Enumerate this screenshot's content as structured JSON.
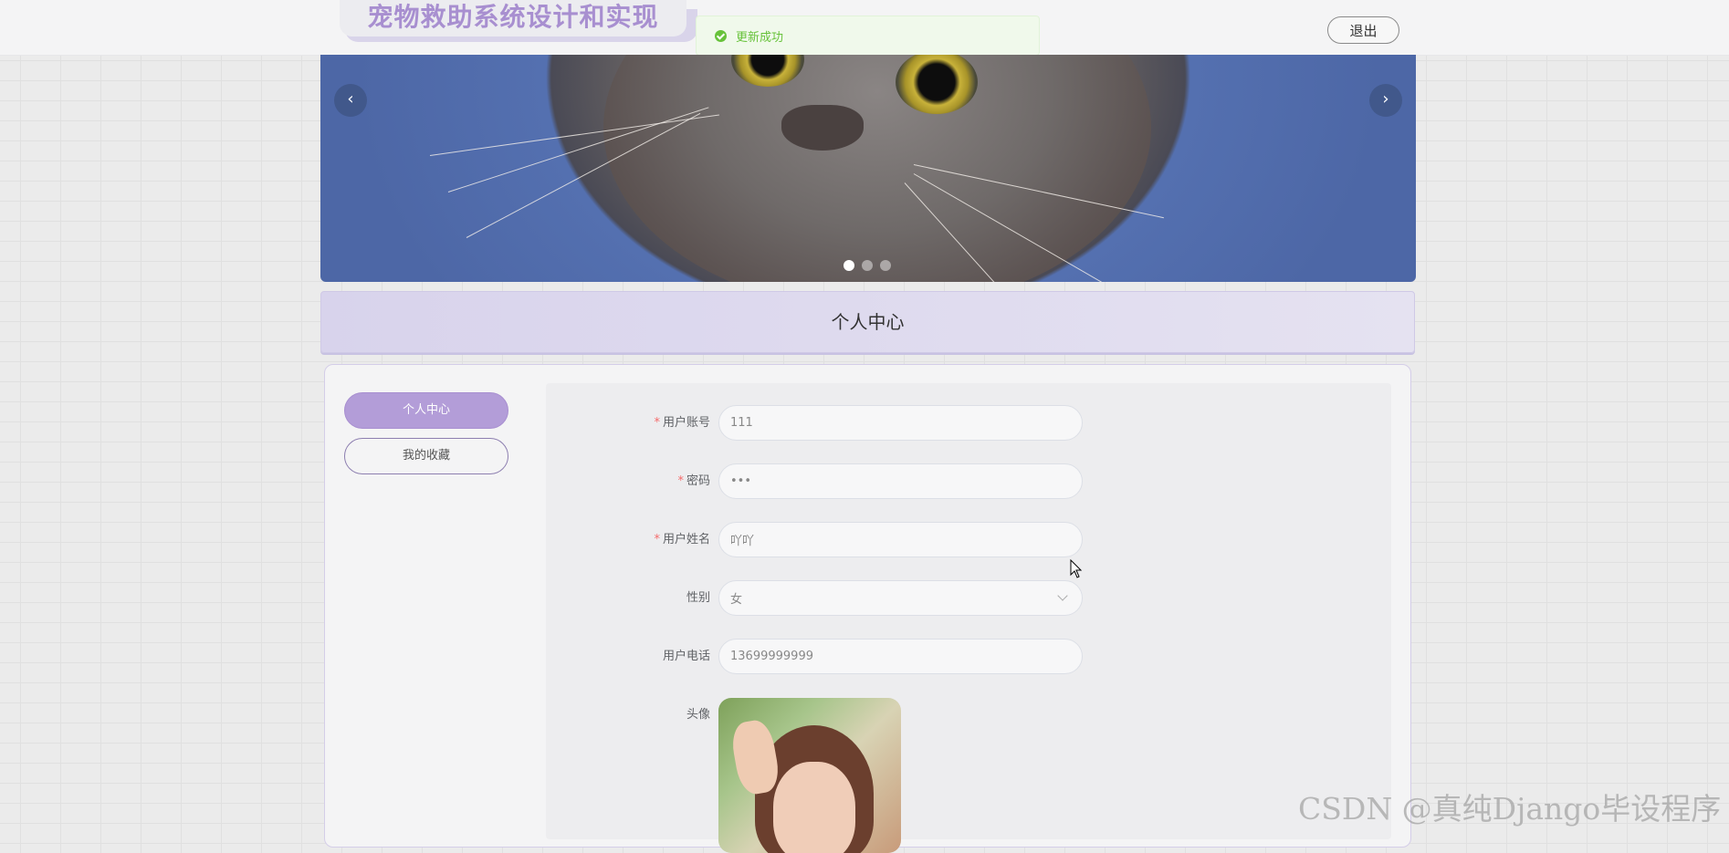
{
  "header": {
    "system_title": "宠物救助系统设计和实现",
    "logout_label": "退出"
  },
  "toast": {
    "message": "更新成功",
    "status_color": "#67c23a"
  },
  "banner": {
    "prev_icon": "‹",
    "next_icon": "›",
    "slide_count": 3,
    "active_slide": 1
  },
  "section": {
    "title": "个人中心"
  },
  "side_menu": {
    "items": [
      {
        "label": "个人中心",
        "active": true
      },
      {
        "label": "我的收藏",
        "active": false
      }
    ]
  },
  "form": {
    "fields": [
      {
        "label": "用户账号",
        "required": true,
        "value": "111"
      },
      {
        "label": "密码",
        "required": true,
        "value": "•••"
      },
      {
        "label": "用户姓名",
        "required": true,
        "value": "吖吖"
      },
      {
        "label": "性别",
        "required": false,
        "value": "女"
      },
      {
        "label": "用户电话",
        "required": false,
        "value": "13699999999"
      },
      {
        "label": "头像",
        "required": false
      }
    ]
  },
  "watermark": "CSDN @真纯Django毕设程序",
  "colors": {
    "accent": "#b39dd8",
    "title_purple": "#a88fd0",
    "required": "#f56c6c"
  }
}
